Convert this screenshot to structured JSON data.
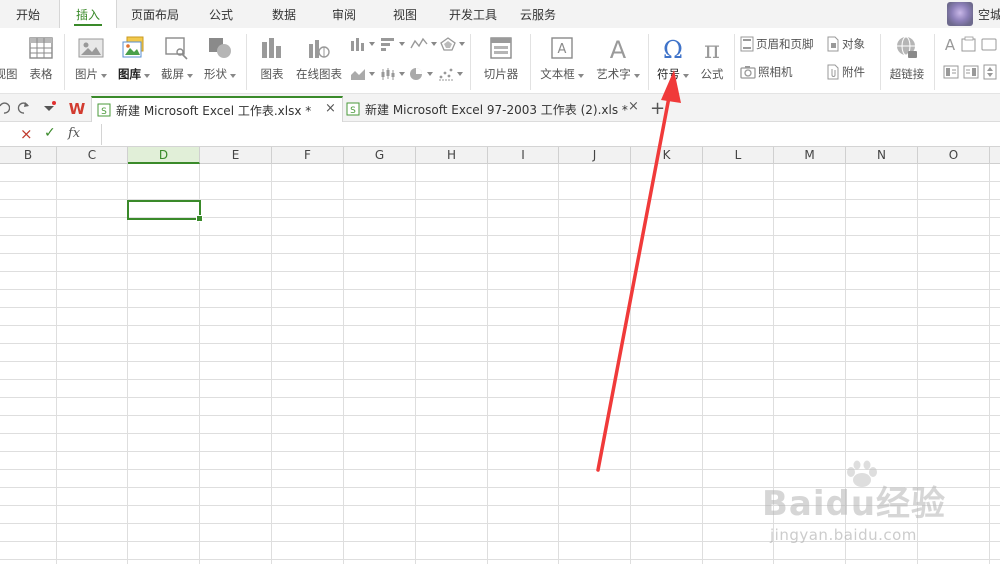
{
  "menu": {
    "tabs": [
      {
        "label": "开始"
      },
      {
        "label": "插入"
      },
      {
        "label": "页面布局"
      },
      {
        "label": "公式"
      },
      {
        "label": "数据"
      },
      {
        "label": "审阅"
      },
      {
        "label": "视图"
      },
      {
        "label": "开发工具"
      },
      {
        "label": "云服务"
      }
    ],
    "active_tab": "插入",
    "user_name": "空城"
  },
  "ribbon": {
    "view": "视图",
    "table": "表格",
    "picture": "图片",
    "gallery": "图库",
    "screenshot": "截屏",
    "shape": "形状",
    "chart": "图表",
    "online_chart": "在线图表",
    "slicer": "切片器",
    "textbox": "文本框",
    "art_text": "艺术字",
    "symbol": "符号",
    "formula": "公式",
    "header_footer": "页眉和页脚",
    "object": "对象",
    "camera": "照相机",
    "attachment": "附件",
    "hyperlink": "超链接"
  },
  "tabstrip": {
    "tabs": [
      {
        "label": "新建 Microsoft Excel 工作表.xlsx *"
      },
      {
        "label": "新建 Microsoft Excel 97-2003 工作表 (2).xls *"
      }
    ],
    "close": "×",
    "add": "+"
  },
  "formula_bar": {
    "cancel": "×",
    "confirm": "✓",
    "fx": "fx",
    "value": ""
  },
  "grid": {
    "columns": [
      "B",
      "C",
      "D",
      "E",
      "F",
      "G",
      "H",
      "I",
      "J",
      "K",
      "L",
      "M",
      "N",
      "O"
    ],
    "selected_column": "D"
  },
  "watermark": {
    "logo": "Baidu经验",
    "url": "jingyan.baidu.com"
  },
  "colors": {
    "accent": "#3a8a2a",
    "arrow": "#f03a3a",
    "symbol_blue": "#3f73c9"
  }
}
